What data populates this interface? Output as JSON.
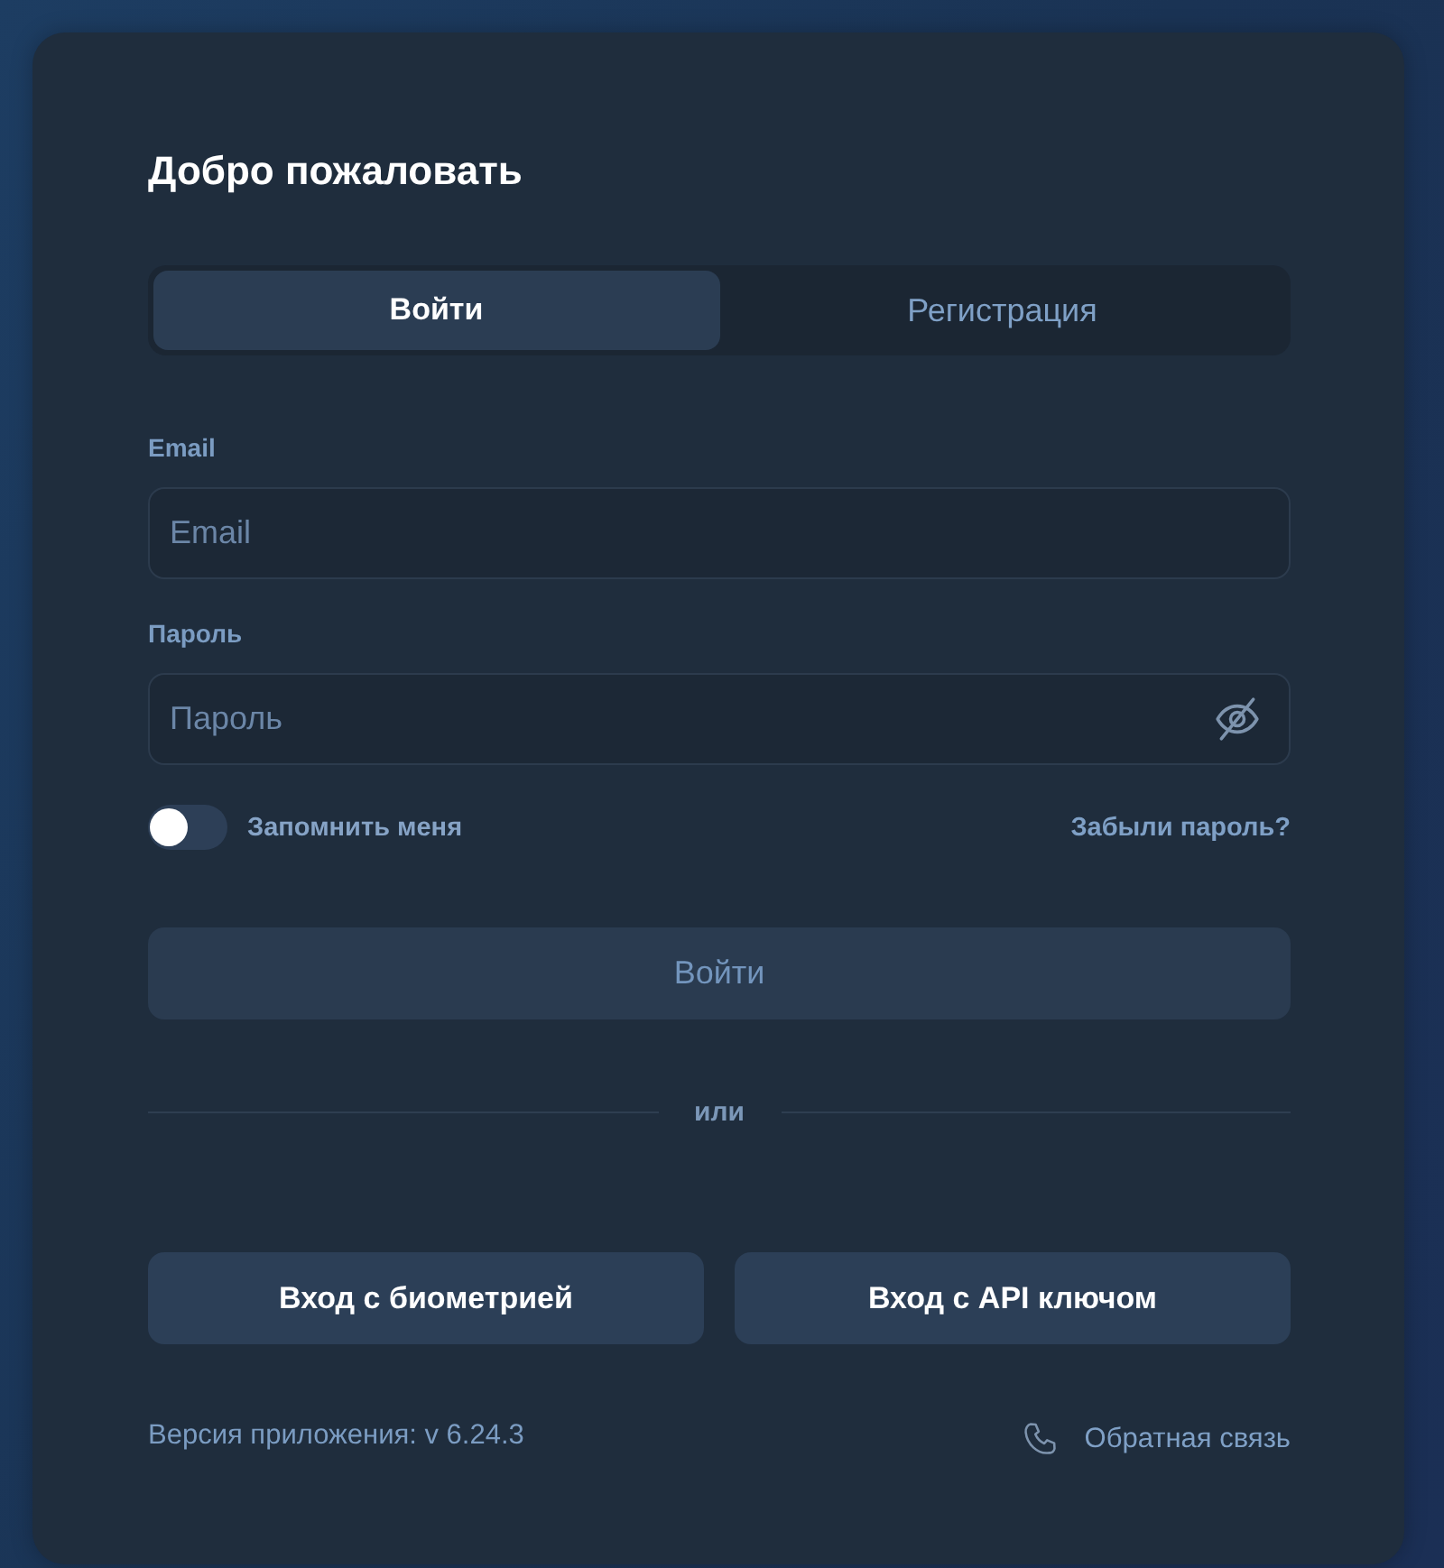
{
  "title": "Добро пожаловать",
  "tabs": [
    {
      "label": "Войти",
      "selected": true
    },
    {
      "label": "Регистрация",
      "selected": false
    }
  ],
  "fields": [
    {
      "kind": "text",
      "label": "Email",
      "placeholder": "Email"
    },
    {
      "kind": "password",
      "label": "Пароль",
      "placeholder": "Пароль"
    }
  ],
  "remember": {
    "label": "Запомнить меня",
    "on": false
  },
  "forgot_link": "Забыли пароль?",
  "submit": {
    "label": "Войти",
    "disabled": true
  },
  "divider": "или",
  "alt_buttons": [
    "Вход с биометрией",
    "Вход с API ключом"
  ],
  "footer": {
    "version": "Версия приложения: v 6.24.3",
    "feedback": "Обратная связь"
  }
}
